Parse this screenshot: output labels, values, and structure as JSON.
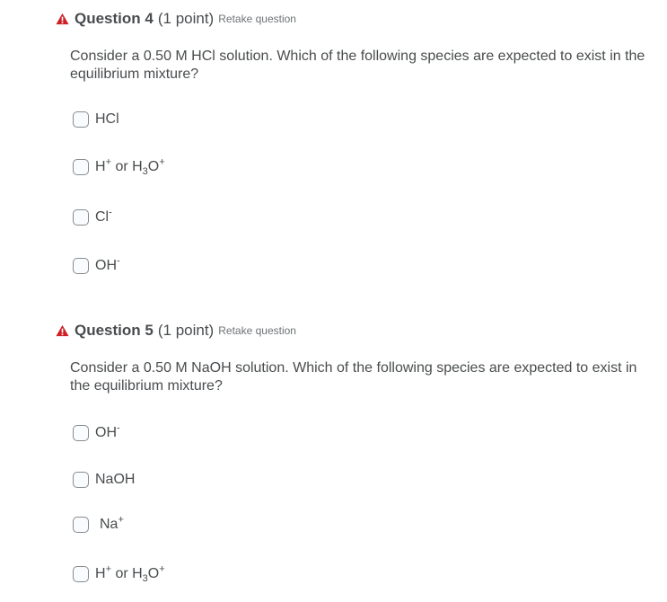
{
  "questions": [
    {
      "title": "Question 4",
      "points": "(1 point)",
      "retake": "Retake question",
      "prompt": "Consider a 0.50 M HCl solution. Which of the following species are expected to exist in the equilibrium mixture?",
      "options": [
        {
          "base": "HCl"
        },
        {
          "h": "H",
          "hplus": "+",
          "or": " or H",
          "sub3": "3",
          "o": "O",
          "oplus": "+"
        },
        {
          "base": "Cl",
          "sup": "-"
        },
        {
          "base": "OH",
          "sup": "-"
        }
      ]
    },
    {
      "title": "Question 5",
      "points": "(1 point)",
      "retake": "Retake question",
      "prompt": "Consider a 0.50 M NaOH solution. Which of the following species are expected to exist in the equilibrium mixture?",
      "options": [
        {
          "base": "OH",
          "sup": "-"
        },
        {
          "base": "NaOH"
        },
        {
          "base": "Na",
          "sup": "+"
        },
        {
          "h": "H",
          "hplus": "+",
          "or": " or H",
          "sub3": "3",
          "o": "O",
          "oplus": "+"
        }
      ]
    }
  ],
  "colors": {
    "text": "#494c4e",
    "warning": "#cd2026",
    "checkbox_border": "#868c8f"
  },
  "icons": {
    "warning": "warning-triangle-icon"
  }
}
